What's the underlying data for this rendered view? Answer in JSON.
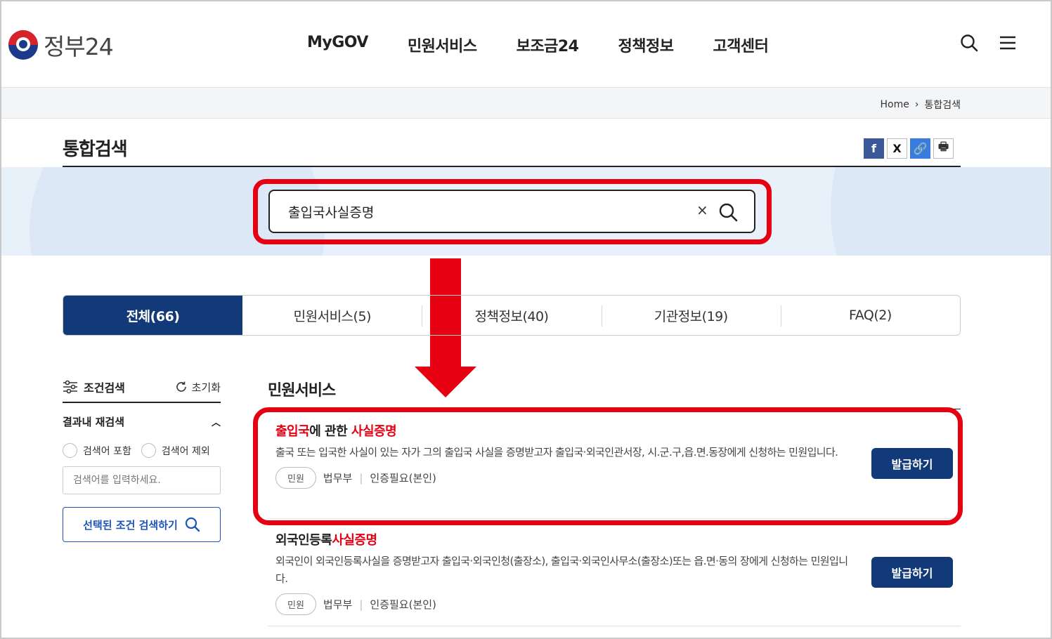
{
  "header": {
    "logo_text": "정부24",
    "nav": [
      "MyGOV",
      "민원서비스",
      "보조금24",
      "정책정보",
      "고객센터"
    ]
  },
  "breadcrumb": {
    "home": "Home",
    "current": "통합검색"
  },
  "page": {
    "title": "통합검색"
  },
  "share": {
    "facebook": "f",
    "x": "X",
    "link": "🔗",
    "print": "🖶"
  },
  "search": {
    "query": "출입국사실증명",
    "clear": "×"
  },
  "tabs": [
    {
      "label": "전체(66)",
      "active": true
    },
    {
      "label": "민원서비스(5)",
      "active": false
    },
    {
      "label": "정책정보(40)",
      "active": false
    },
    {
      "label": "기관정보(19)",
      "active": false
    },
    {
      "label": "FAQ(2)",
      "active": false
    }
  ],
  "sidebar": {
    "cond_label": "조건검색",
    "reset_label": "초기화",
    "research_title": "결과내 재검색",
    "include_label": "검색어 포함",
    "exclude_label": "검색어 제외",
    "keyword_placeholder": "검색어를 입력하세요.",
    "cond_search_button": "선택된 조건 검색하기"
  },
  "results": {
    "section_title": "민원서비스",
    "items": [
      {
        "title_hl1": "출입국",
        "title_mid": "에 관한 ",
        "title_hl2": "사실증명",
        "desc": "출국 또는 입국한 사실이 있는 자가 그의 출입국 사실을 증명받고자 출입국·외국인관서장, 시.군.구,읍.면.동장에게 신청하는 민원입니다.",
        "tag": "민원",
        "org": "법무부",
        "auth": "인증필요(본인)",
        "button": "발급하기"
      },
      {
        "title_plain": "외국인등록",
        "title_hl": "사실증명",
        "desc": "외국인이 외국인등록사실을 증명받고자 출입국·외국인청(출장소), 출입국·외국인사무소(출장소)또는 읍.면·동의 장에게 신청하는 민원입니다.",
        "tag": "민원",
        "org": "법무부",
        "auth": "인증필요(본인)",
        "button": "발급하기"
      }
    ]
  },
  "colors": {
    "accent_navy": "#123a78",
    "highlight_red": "#e50012",
    "band_blue": "#e8f0fa"
  }
}
